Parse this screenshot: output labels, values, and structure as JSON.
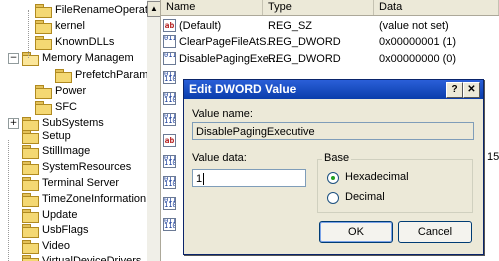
{
  "tree": {
    "items": [
      {
        "label": "FileRenameOperat",
        "expander": ""
      },
      {
        "label": "kernel",
        "expander": ""
      },
      {
        "label": "KnownDLLs",
        "expander": ""
      },
      {
        "label": "Memory Managem",
        "expander": "−"
      },
      {
        "label": "PrefetchParam",
        "expander": ""
      },
      {
        "label": "Power",
        "expander": ""
      },
      {
        "label": "SFC",
        "expander": ""
      },
      {
        "label": "SubSystems",
        "expander": "+"
      },
      {
        "label": "Setup",
        "expander": ""
      },
      {
        "label": "StillImage",
        "expander": ""
      },
      {
        "label": "SystemResources",
        "expander": ""
      },
      {
        "label": "Terminal Server",
        "expander": ""
      },
      {
        "label": "TimeZoneInformation",
        "expander": ""
      },
      {
        "label": "Update",
        "expander": ""
      },
      {
        "label": "UsbFlags",
        "expander": ""
      },
      {
        "label": "Video",
        "expander": ""
      },
      {
        "label": "VirtualDeviceDrivers",
        "expander": ""
      }
    ],
    "scroll_up_glyph": "▲"
  },
  "list": {
    "columns": {
      "name": "Name",
      "type": "Type",
      "data": "Data"
    },
    "rows": [
      {
        "name": "(Default)",
        "type": "REG_SZ",
        "data": "(value not set)",
        "icon": "ab"
      },
      {
        "name": "ClearPageFileAtS...",
        "type": "REG_DWORD",
        "data": "0x00000001 (1)",
        "icon": "011 110"
      },
      {
        "name": "DisablePagingExe...",
        "type": "REG_DWORD",
        "data": "0x00000000 (0)",
        "icon": "011 110"
      }
    ],
    "partial_text": "15",
    "side_icons": [
      "011 110",
      "011 110",
      "011 110",
      "ab",
      "011 110",
      "011 110",
      "011 110",
      "011 110"
    ]
  },
  "dialog": {
    "title": "Edit DWORD Value",
    "help_label": "?",
    "close_label": "✕",
    "value_name_label": "Value name:",
    "value_name": "DisablePagingExecutive",
    "value_data_label": "Value data:",
    "value_data": "1",
    "base_label": "Base",
    "hex_label": "Hexadecimal",
    "dec_label": "Decimal",
    "base_selected": "Hexadecimal",
    "ok_label": "OK",
    "cancel_label": "Cancel"
  }
}
